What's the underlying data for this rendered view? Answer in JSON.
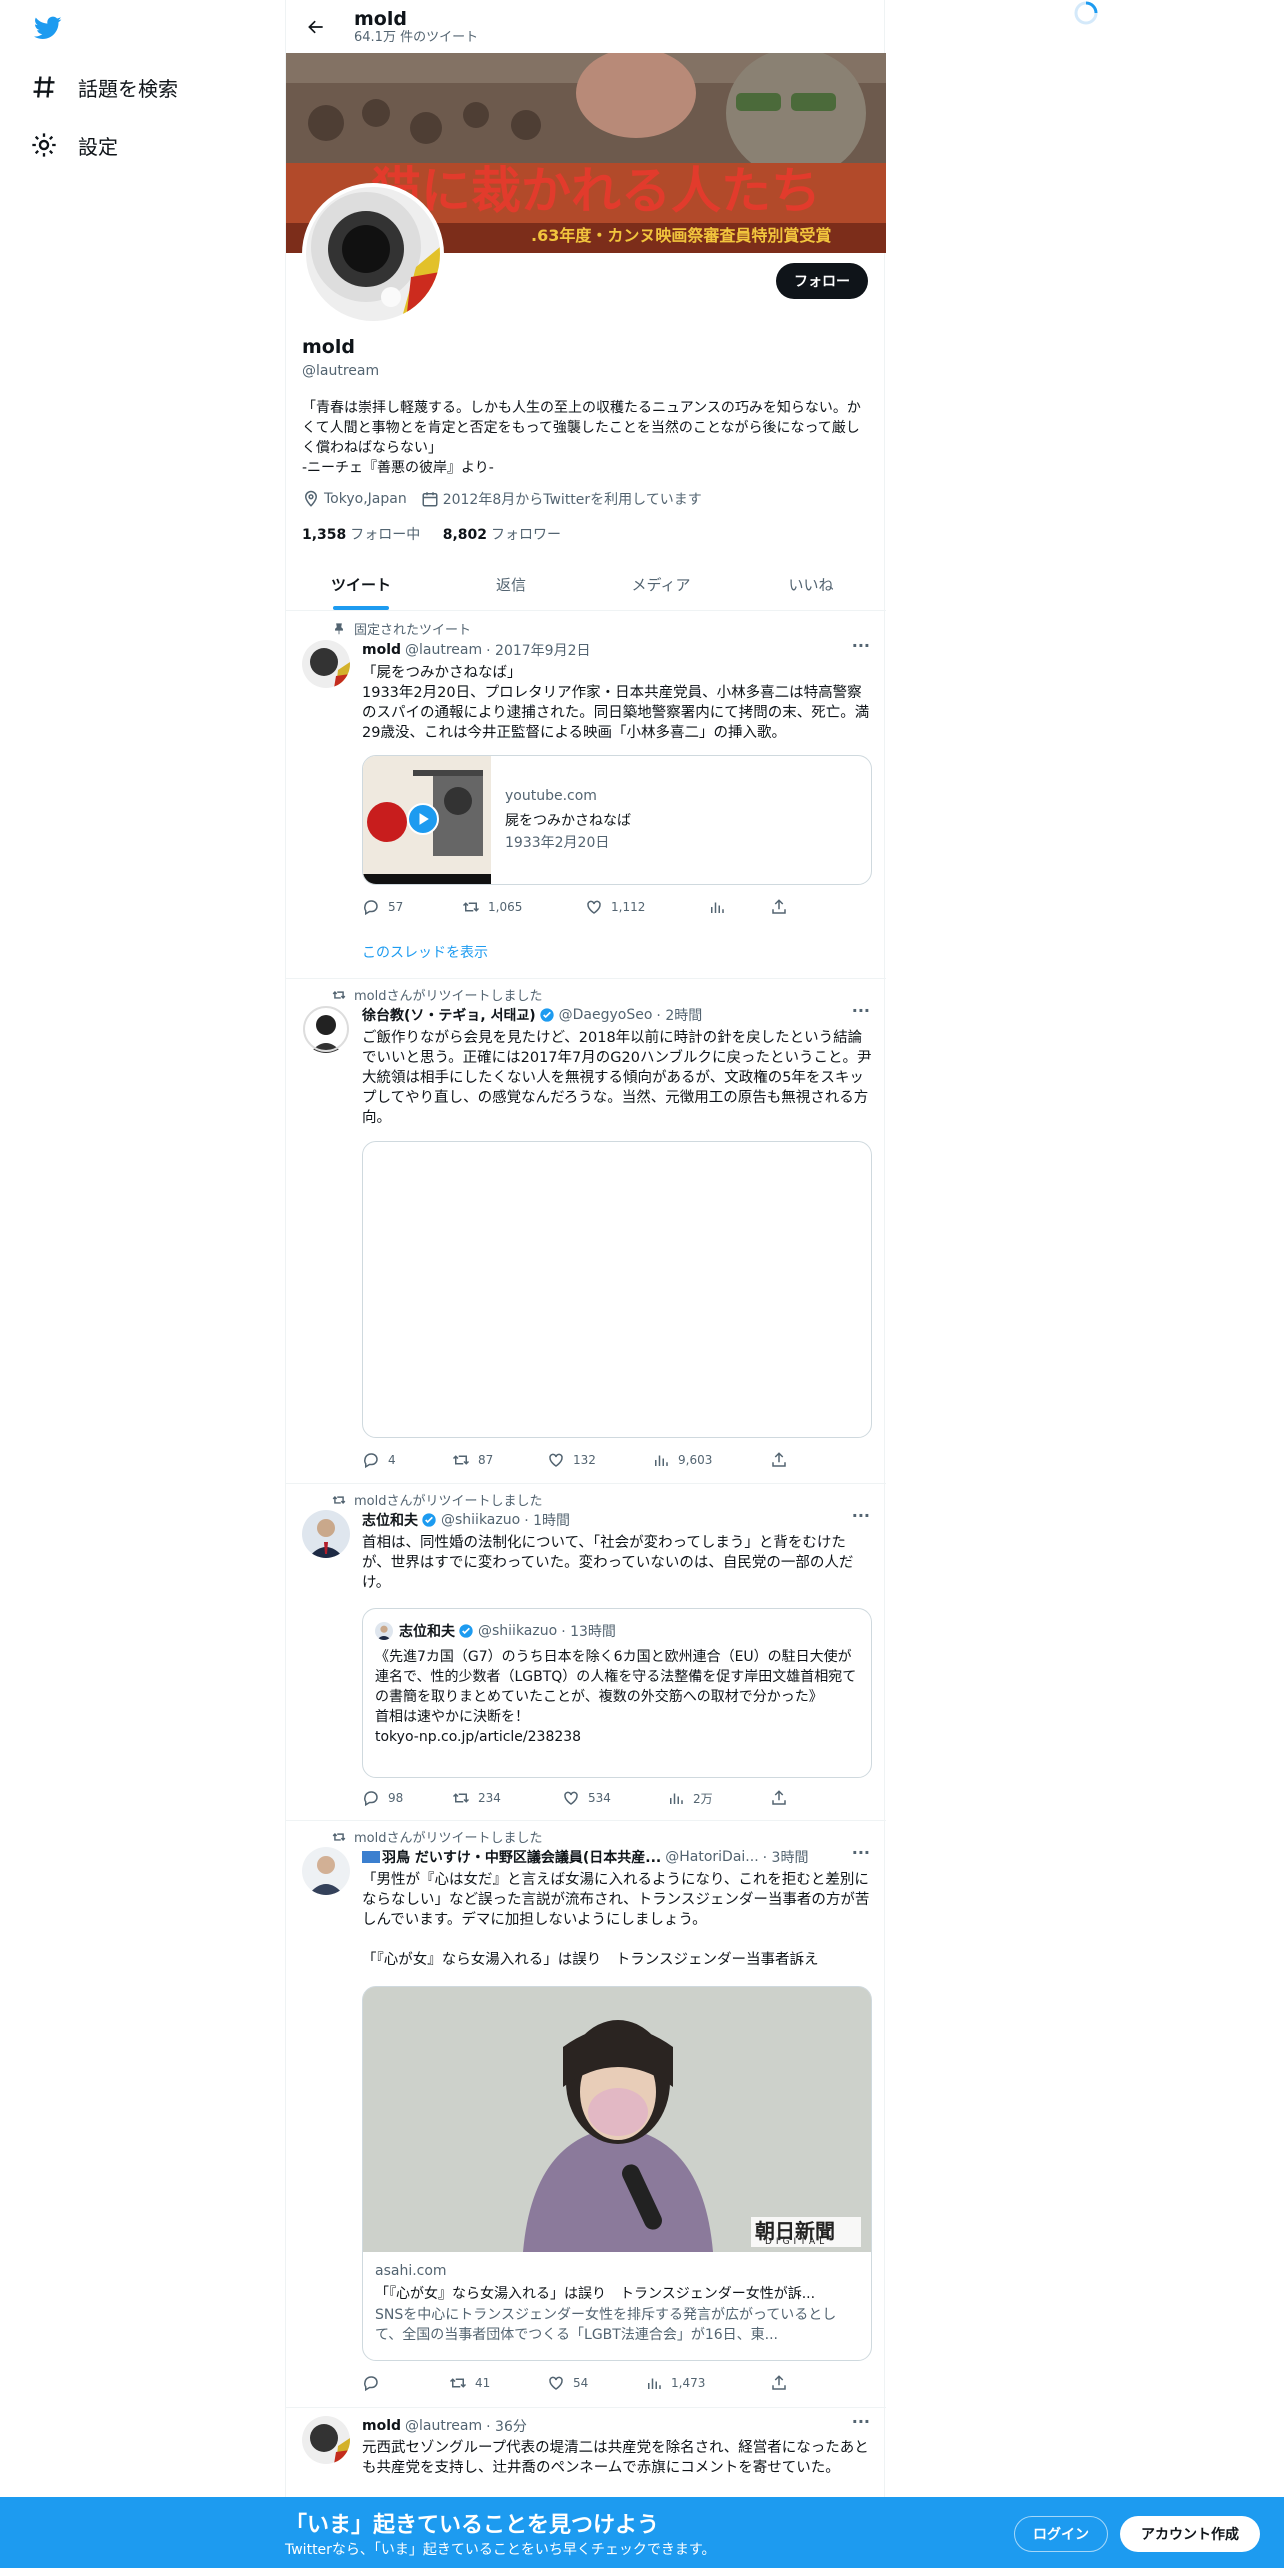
{
  "nav": {
    "items": [
      {
        "label": "話題を検索",
        "icon": "hashtag-icon"
      },
      {
        "label": "設定",
        "icon": "gear-icon"
      }
    ]
  },
  "header": {
    "name": "mold",
    "tweet_count": "64.1万 件のツイート"
  },
  "profile": {
    "name": "mold",
    "handle": "@lautream",
    "follow_label": "フォロー",
    "bio": "「青春は崇拝し軽蔑する。しかも人生の至上の収穫たるニュアンスの巧みを知らない。かくて人間と事物とを肯定と否定をもって強襲したことを当然のことながら後になって厳しく償わねばならない」\n-ニーチェ『善悪の彼岸』より-",
    "location": "Tokyo,Japan",
    "joined": "2012年8月からTwitterを利用しています",
    "following_count": "1,358",
    "following_label": "フォロー中",
    "followers_count": "8,802",
    "followers_label": "フォロワー",
    "banner_text": "猫に裁かれる人たち",
    "banner_subtext": ".63年度・カンヌ映画祭審査員特別賞受賞"
  },
  "tabs": [
    "ツイート",
    "返信",
    "メディア",
    "いいね"
  ],
  "tweets": [
    {
      "context": "固定されたツイート",
      "name": "mold",
      "handle": "@lautream",
      "time": "· 2017年9月2日",
      "text": "「屍をつみかさねなば」\n1933年2月20日、プロレタリア作家・日本共産党員、小林多喜二は特高警察のスパイの通報により逮捕された。同日築地警察署内にて拷問の末、死亡。満29歳没、これは今井正監督による映画「小林多喜二」の挿入歌。",
      "card": {
        "domain": "youtube.com",
        "title": "屍をつみかさねなば",
        "desc": "1933年2月20日"
      },
      "replies": "57",
      "retweets": "1,065",
      "likes": "1,112",
      "thread_link": "このスレッドを表示"
    },
    {
      "context": "moldさんがリツイートしました",
      "name": "徐台教(ソ・テギョ, 서태교)",
      "handle": "@DaegyoSeo",
      "time": "· 2時間",
      "text": "ご飯作りながら会見を見たけど、2018年以前に時計の針を戻したという結論でいいと思う。正確には2017年7月のG20ハンブルクに戻ったということ。尹大統領は相手にしたくない人を無視する傾向があるが、文政権の5年をスキップしてやり直し、の感覚なんだろうな。当然、元徴用工の原告も無視される方向。",
      "replies": "4",
      "retweets": "87",
      "likes": "132",
      "views": "9,603"
    },
    {
      "context": "moldさんがリツイートしました",
      "name": "志位和夫",
      "handle": "@shiikazuo",
      "time": "· 1時間",
      "text": "首相は、同性婚の法制化について、「社会が変わってしまう」と背をむけたが、世界はすでに変わっていた。変わっていないのは、自民党の一部の人だけ。",
      "quote": {
        "name": "志位和夫",
        "handle": "@shiikazuo",
        "time": "· 13時間",
        "text": "《先進7カ国（G7）のうち日本を除く6カ国と欧州連合（EU）の駐日大使が連名で、性的少数者（LGBTQ）の人権を守る法整備を促す岸田文雄首相宛ての書簡を取りまとめていたことが、複数の外交筋への取材で分かった》\n首相は速やかに決断を！\ntokyo-np.co.jp/article/238238"
      },
      "replies": "98",
      "retweets": "234",
      "likes": "534",
      "views": "2万"
    },
    {
      "context": "moldさんがリツイートしました",
      "name": "羽鳥 だいすけ・中野区議会議員(日本共産...",
      "handle": "@HatoriDai...",
      "time": "· 3時間",
      "text": "「男性が『心は女だ』と言えば女湯に入れるようになり、これを拒むと差別にならなしい」など誤った言説が流布され、トランスジェンダー当事者の方が苦しんでいます。デマに加担しないようにしましょう。\n\n「『心が女』なら女湯入れる」は誤り　トランスジェンダー当事者訴え",
      "card": {
        "domain": "asahi.com",
        "title": "「『心が女』なら女湯入れる」は誤り　トランスジェンダー女性が訴...",
        "desc": "SNSを中心にトランスジェンダー女性を排斥する発言が広がっているとして、全国の当事者団体でつくる「LGBT法連合会」が16日、東...",
        "logo": "朝日新聞",
        "logo_sub": "DIGITAL"
      },
      "replies": "",
      "retweets": "41",
      "likes": "54",
      "views": "1,473"
    },
    {
      "name": "mold",
      "handle": "@lautream",
      "time": "· 36分",
      "text": "元西武セゾングループ代表の堤清二は共産党を除名され、経営者になったあとも共産党を支持し、辻井喬のペンネームで赤旗にコメントを寄せていた。"
    }
  ],
  "bottom": {
    "title": "「いま」起きていることを見つけよう",
    "subtitle": "Twitterなら、「いま」起きていることをいち早くチェックできます。",
    "login": "ログイン",
    "signup": "アカウント作成"
  }
}
